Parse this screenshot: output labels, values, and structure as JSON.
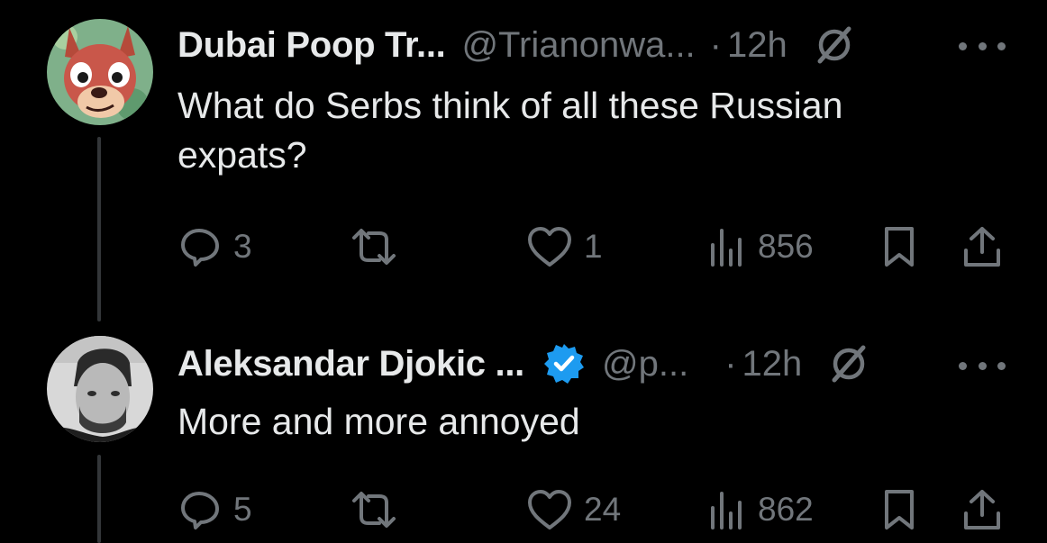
{
  "colors": {
    "background": "#000000",
    "text": "#e7e9ea",
    "muted": "#71767b",
    "verified": "#1d9bf0",
    "thread": "#333639"
  },
  "tweets": [
    {
      "name": "Dubai Poop Tr...",
      "handle": "@Trianonwa...",
      "dot": "·",
      "time": "12h",
      "verified": false,
      "text_lines": [
        "What do Serbs think of all these Russian",
        "expats?"
      ],
      "replies": "3",
      "reposts": "",
      "likes": "1",
      "views": "856",
      "avatar_icon": "cartoon-fox-avatar"
    },
    {
      "name": "Aleksandar Djokic ...",
      "handle": "@p...",
      "dot": "·",
      "time": "12h",
      "verified": true,
      "text_lines": [
        "More and more annoyed"
      ],
      "replies": "5",
      "reposts": "",
      "likes": "24",
      "views": "862",
      "avatar_icon": "person-photo-avatar"
    }
  ]
}
